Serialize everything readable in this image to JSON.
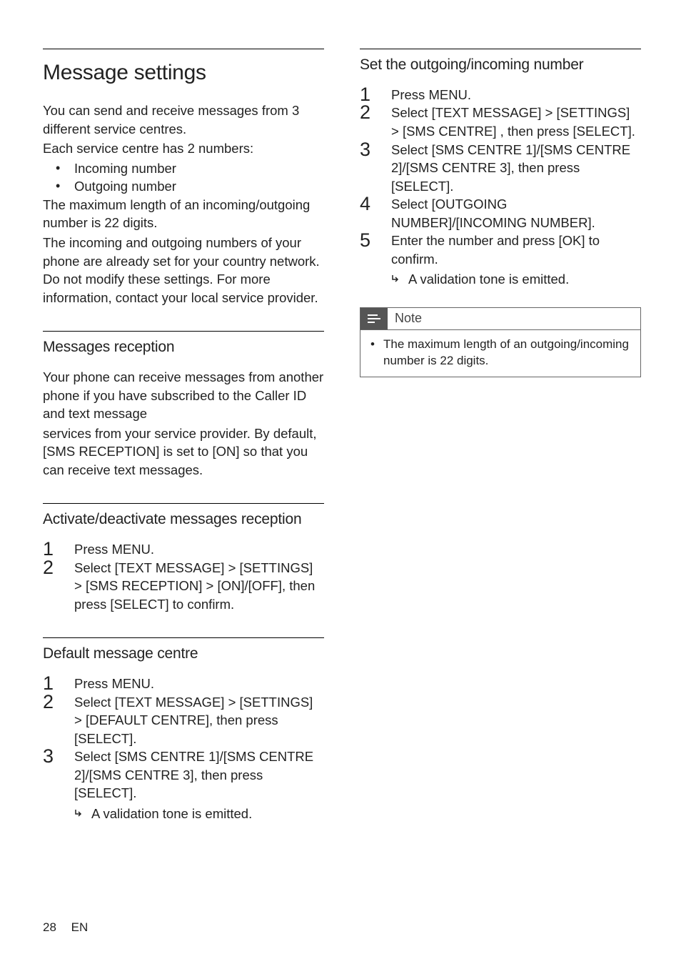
{
  "left": {
    "h1": "Message settings",
    "intro_p1": "You can send and receive messages from 3 different service centres.",
    "intro_p2": "Each service centre has 2 numbers:",
    "bullets": [
      "Incoming number",
      "Outgoing number"
    ],
    "intro_p3": "The maximum length of an incoming/outgoing number is 22 digits.",
    "intro_p4": "The incoming and outgoing numbers of your phone are already set for your country network. Do not modify these settings. For more information, contact your local service provider.",
    "h2_reception": "Messages reception",
    "reception_p_a": "Your phone can receive messages from another phone if you have subscribed to the Caller ID and text message",
    "reception_p_b": "services from your service provider. By default, ",
    "reception_bold1": "[SMS RECEPTION]",
    "reception_mid": " is set to ",
    "reception_bold2": "[ON]",
    "reception_tail": " so that you can receive text messages.",
    "h2_activate": "Activate/deactivate messages reception",
    "act_step1_a": "Press ",
    "act_step1_b": "MENU",
    "act_step1_c": ".",
    "act_step2_a": "Select ",
    "act_step2_b": "[TEXT MESSAGE]",
    "act_step2_c": " > ",
    "act_step2_d": "[SETTINGS]",
    "act_step2_e": " > ",
    "act_step2_f": "[SMS RECEPTION]",
    "act_step2_g": " > ",
    "act_step2_h": "[ON]",
    "act_step2_i": "/",
    "act_step2_j": "[OFF]",
    "act_step2_k": ", then press ",
    "act_step2_l": "[SELECT]",
    "act_step2_m": " to confirm.",
    "h2_default": "Default message centre",
    "def_step1_a": "Press ",
    "def_step1_b": "MENU",
    "def_step1_c": ".",
    "def_step2_a": "Select ",
    "def_step2_b": "[TEXT MESSAGE]",
    "def_step2_c": " > ",
    "def_step2_d": "[SETTINGS]",
    "def_step2_e": " > ",
    "def_step2_f": "[DEFAULT CENTRE]",
    "def_step2_g": ", then press ",
    "def_step2_h": "[SELECT]",
    "def_step2_i": ".",
    "def_step3_a": "Select ",
    "def_step3_b": "[SMS CENTRE 1]",
    "def_step3_c": "/",
    "def_step3_d": "[SMS CENTRE 2]",
    "def_step3_e": "/",
    "def_step3_f": "[SMS CENTRE 3]",
    "def_step3_g": ", then press ",
    "def_step3_h": "[SELECT]",
    "def_step3_i": ".",
    "def_result": "A validation tone is emitted."
  },
  "right": {
    "h2_set": "Set the outgoing/incoming number",
    "s1_a": "Press ",
    "s1_b": "MENU",
    "s1_c": ".",
    "s2_a": "Select ",
    "s2_b": "[TEXT MESSAGE]",
    "s2_c": " > ",
    "s2_d": "[SETTINGS]",
    "s2_e": " > ",
    "s2_f": "[SMS CENTRE]",
    "s2_g": " , then press ",
    "s2_h": "[SELECT]",
    "s2_i": ".",
    "s3_a": "Select ",
    "s3_b": "[SMS CENTRE 1]",
    "s3_c": "/",
    "s3_d": "[SMS CENTRE 2]",
    "s3_e": "/",
    "s3_f": "[SMS CENTRE 3]",
    "s3_g": ", then press ",
    "s3_h": "[SELECT]",
    "s3_i": ".",
    "s4_a": "Select ",
    "s4_b": "[OUTGOING NUMBER]",
    "s4_c": "/",
    "s4_d": "[INCOMING NUMBER]",
    "s4_e": ".",
    "s5_a": "Enter the number and press ",
    "s5_b": "[OK]",
    "s5_c": " to confirm.",
    "s5_result": "A validation tone is emitted.",
    "note_title": "Note",
    "note_item": "The maximum length of an outgoing/incoming number is 22 digits."
  },
  "footer": {
    "page": "28",
    "lang": "EN"
  }
}
